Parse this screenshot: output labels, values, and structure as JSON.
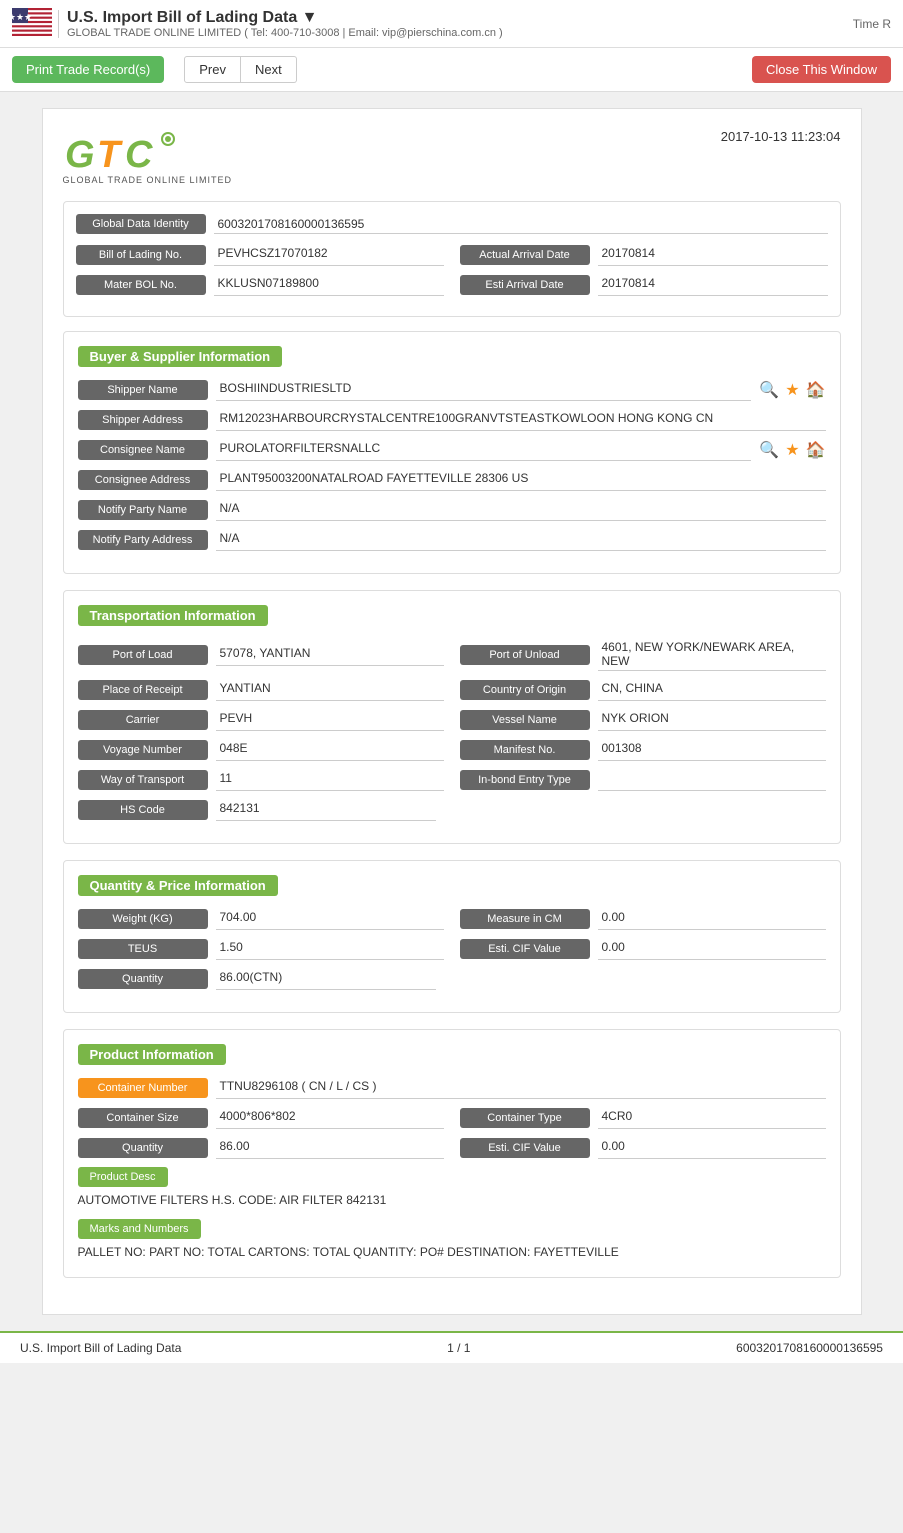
{
  "header": {
    "app_title": "U.S. Import Bill of Lading Data ▼",
    "subtitle": "GLOBAL TRADE ONLINE LIMITED ( Tel: 400-710-3008 | Email: vip@pierschina.com.cn )",
    "time_label": "Time R"
  },
  "toolbar": {
    "print_label": "Print Trade Record(s)",
    "prev_label": "Prev",
    "next_label": "Next",
    "close_label": "Close This Window"
  },
  "logo": {
    "text": "GTC",
    "subtitle": "GLOBAL TRADE ONLINE LIMITED",
    "record_date": "2017-10-13 11:23:04"
  },
  "global_data": {
    "identity_label": "Global Data Identity",
    "identity_value": "6003201708160000136595",
    "bol_label": "Bill of Lading No.",
    "bol_value": "PEVHCSZ17070182",
    "actual_arrival_label": "Actual Arrival Date",
    "actual_arrival_value": "20170814",
    "master_bol_label": "Mater BOL No.",
    "master_bol_value": "KKLUSN07189800",
    "esti_arrival_label": "Esti Arrival Date",
    "esti_arrival_value": "20170814"
  },
  "buyer_supplier": {
    "section_title": "Buyer & Supplier Information",
    "shipper_name_label": "Shipper Name",
    "shipper_name_value": "BOSHIINDUSTRIESLTD",
    "shipper_address_label": "Shipper Address",
    "shipper_address_value": "RM12023HARBOURCRYSTALCENTRE100GRANVTSTEASTKOWLOON HONG KONG CN",
    "consignee_name_label": "Consignee Name",
    "consignee_name_value": "PUROLATORFILTERSNALLC",
    "consignee_address_label": "Consignee Address",
    "consignee_address_value": "PLANT95003200NATALROAD FAYETTEVILLE 28306 US",
    "notify_party_name_label": "Notify Party Name",
    "notify_party_name_value": "N/A",
    "notify_party_address_label": "Notify Party Address",
    "notify_party_address_value": "N/A"
  },
  "transportation": {
    "section_title": "Transportation Information",
    "port_of_load_label": "Port of Load",
    "port_of_load_value": "57078, YANTIAN",
    "port_of_unload_label": "Port of Unload",
    "port_of_unload_value": "4601, NEW YORK/NEWARK AREA, NEW",
    "place_of_receipt_label": "Place of Receipt",
    "place_of_receipt_value": "YANTIAN",
    "country_of_origin_label": "Country of Origin",
    "country_of_origin_value": "CN, CHINA",
    "carrier_label": "Carrier",
    "carrier_value": "PEVH",
    "vessel_name_label": "Vessel Name",
    "vessel_name_value": "NYK ORION",
    "voyage_number_label": "Voyage Number",
    "voyage_number_value": "048E",
    "manifest_no_label": "Manifest No.",
    "manifest_no_value": "001308",
    "way_of_transport_label": "Way of Transport",
    "way_of_transport_value": "11",
    "inbond_entry_label": "In-bond Entry Type",
    "inbond_entry_value": "",
    "hs_code_label": "HS Code",
    "hs_code_value": "842131"
  },
  "quantity_price": {
    "section_title": "Quantity & Price Information",
    "weight_label": "Weight (KG)",
    "weight_value": "704.00",
    "measure_label": "Measure in CM",
    "measure_value": "0.00",
    "teus_label": "TEUS",
    "teus_value": "1.50",
    "esti_cif_label": "Esti. CIF Value",
    "esti_cif_value": "0.00",
    "quantity_label": "Quantity",
    "quantity_value": "86.00(CTN)"
  },
  "product_info": {
    "section_title": "Product Information",
    "container_number_label": "Container Number",
    "container_number_value": "TTNU8296108 ( CN / L / CS )",
    "container_size_label": "Container Size",
    "container_size_value": "4000*806*802",
    "container_type_label": "Container Type",
    "container_type_value": "4CR0",
    "quantity_label": "Quantity",
    "quantity_value": "86.00",
    "esti_cif_label": "Esti. CIF Value",
    "esti_cif_value": "0.00",
    "product_desc_label": "Product Desc",
    "product_desc_text": "AUTOMOTIVE FILTERS H.S. CODE: AIR FILTER 842131",
    "marks_label": "Marks and Numbers",
    "marks_text": "PALLET NO: PART NO: TOTAL CARTONS: TOTAL QUANTITY: PO# DESTINATION: FAYETTEVILLE"
  },
  "footer": {
    "page_label": "U.S. Import Bill of Lading Data",
    "pagination": "1 / 1",
    "record_id": "6003201708160000136595"
  }
}
